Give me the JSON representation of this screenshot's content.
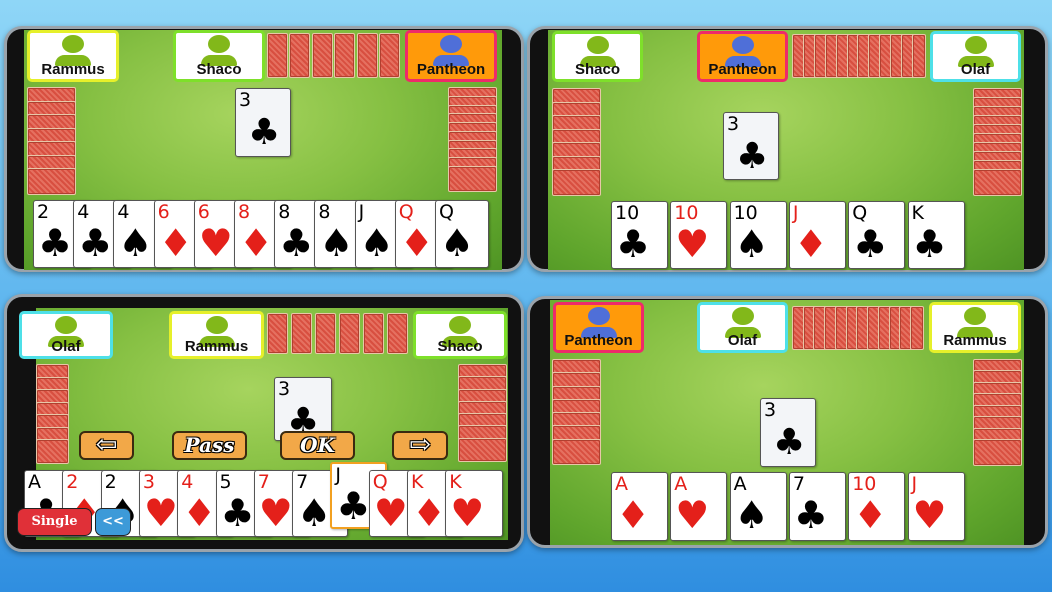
{
  "colors": {
    "active_player_bg": "#ff9a0a",
    "felt": "#86c043",
    "red_suit": "#e4201a",
    "card_back": "#d84f40"
  },
  "panels": [
    {
      "players": [
        {
          "name": "Rammus",
          "active": false,
          "border": "#e6f02a"
        },
        {
          "name": "Shaco",
          "active": false,
          "border": "#7ee02a"
        },
        {
          "name": "Pantheon",
          "active": true,
          "border": "#ee2a6a"
        }
      ],
      "top_backs": 6,
      "left_backs": 7,
      "right_backs": 10,
      "table_card": {
        "rank": "3",
        "suit": "♣"
      },
      "hand": [
        {
          "rank": "2",
          "suit": "♣"
        },
        {
          "rank": "4",
          "suit": "♣"
        },
        {
          "rank": "4",
          "suit": "♠"
        },
        {
          "rank": "6",
          "suit": "♦"
        },
        {
          "rank": "6",
          "suit": "♥"
        },
        {
          "rank": "8",
          "suit": "♦"
        },
        {
          "rank": "8",
          "suit": "♣"
        },
        {
          "rank": "8",
          "suit": "♠"
        },
        {
          "rank": "J",
          "suit": "♠"
        },
        {
          "rank": "Q",
          "suit": "♦"
        },
        {
          "rank": "Q",
          "suit": "♠"
        }
      ]
    },
    {
      "players": [
        {
          "name": "Shaco",
          "active": false,
          "border": "#7ee02a"
        },
        {
          "name": "Pantheon",
          "active": true,
          "border": "#ee2a6a"
        },
        {
          "name": "Olaf",
          "active": false,
          "border": "#4ee0e8"
        }
      ],
      "top_backs": 12,
      "left_backs": 7,
      "right_backs": 10,
      "table_card": {
        "rank": "3",
        "suit": "♣"
      },
      "hand": [
        {
          "rank": "10",
          "suit": "♣"
        },
        {
          "rank": "10",
          "suit": "♥"
        },
        {
          "rank": "10",
          "suit": "♠"
        },
        {
          "rank": "J",
          "suit": "♦"
        },
        {
          "rank": "Q",
          "suit": "♣"
        },
        {
          "rank": "K",
          "suit": "♣"
        }
      ]
    },
    {
      "players": [
        {
          "name": "Olaf",
          "active": false,
          "border": "#4ee0e8"
        },
        {
          "name": "Rammus",
          "active": false,
          "border": "#e6f02a"
        },
        {
          "name": "Shaco",
          "active": false,
          "border": "#7ee02a"
        }
      ],
      "top_backs": 6,
      "left_backs": 7,
      "right_backs": 7,
      "table_card": {
        "rank": "3",
        "suit": "♣"
      },
      "hand": [
        {
          "rank": "A",
          "suit": "♣"
        },
        {
          "rank": "2",
          "suit": "♦"
        },
        {
          "rank": "2",
          "suit": "♠"
        },
        {
          "rank": "3",
          "suit": "♥"
        },
        {
          "rank": "4",
          "suit": "♦"
        },
        {
          "rank": "5",
          "suit": "♣"
        },
        {
          "rank": "7",
          "suit": "♥"
        },
        {
          "rank": "7",
          "suit": "♠"
        },
        {
          "rank": "J",
          "suit": "♣",
          "selected": true
        },
        {
          "rank": "Q",
          "suit": "♥"
        },
        {
          "rank": "K",
          "suit": "♦"
        },
        {
          "rank": "K",
          "suit": "♥"
        }
      ],
      "controls": {
        "left_arrow": "⇦",
        "pass": "Pass",
        "ok": "OK",
        "right_arrow": "⇨",
        "single": "Single",
        "back": "<<"
      }
    },
    {
      "players": [
        {
          "name": "Pantheon",
          "active": true,
          "border": "#ee2a6a"
        },
        {
          "name": "Olaf",
          "active": false,
          "border": "#4ee0e8"
        },
        {
          "name": "Rammus",
          "active": false,
          "border": "#e6f02a"
        }
      ],
      "top_backs": 12,
      "left_backs": 7,
      "right_backs": 8,
      "table_card": {
        "rank": "3",
        "suit": "♣"
      },
      "hand": [
        {
          "rank": "A",
          "suit": "♦"
        },
        {
          "rank": "A",
          "suit": "♥"
        },
        {
          "rank": "A",
          "suit": "♠"
        },
        {
          "rank": "7",
          "suit": "♣"
        },
        {
          "rank": "10",
          "suit": "♦"
        },
        {
          "rank": "J",
          "suit": "♥"
        }
      ]
    }
  ]
}
